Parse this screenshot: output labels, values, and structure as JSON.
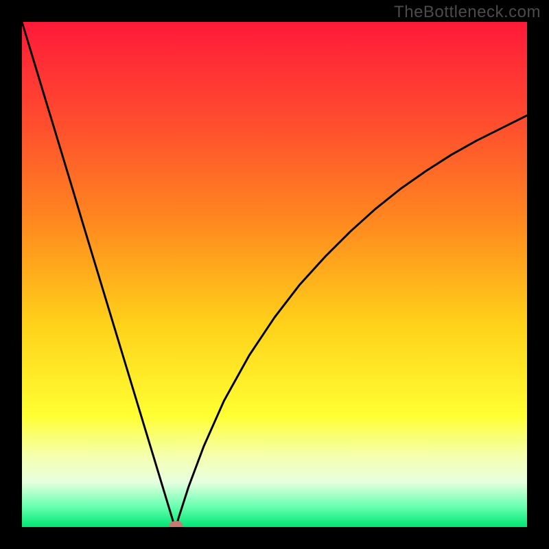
{
  "watermark": "TheBottleneck.com",
  "colors": {
    "frame": "#000000",
    "watermark_text": "#4b4b4b",
    "marker_fill": "#c77a6f",
    "curve_stroke": "#000000",
    "gradient_stops": [
      {
        "offset": 0.0,
        "color": "#ff1a3a"
      },
      {
        "offset": 0.2,
        "color": "#ff4d2e"
      },
      {
        "offset": 0.4,
        "color": "#ff8a1f"
      },
      {
        "offset": 0.6,
        "color": "#ffd21a"
      },
      {
        "offset": 0.78,
        "color": "#ffff33"
      },
      {
        "offset": 0.86,
        "color": "#f4ffb0"
      },
      {
        "offset": 0.91,
        "color": "#e9ffe0"
      },
      {
        "offset": 0.96,
        "color": "#66ffb0"
      },
      {
        "offset": 1.0,
        "color": "#00e673"
      }
    ]
  },
  "chart_data": {
    "type": "line",
    "title": "",
    "xlabel": "",
    "ylabel": "",
    "ylim": [
      0,
      100
    ],
    "x": [
      0.0,
      0.02,
      0.04,
      0.06,
      0.08,
      0.1,
      0.12,
      0.14,
      0.16,
      0.18,
      0.2,
      0.22,
      0.24,
      0.26,
      0.28,
      0.3,
      0.305,
      0.31,
      0.33,
      0.36,
      0.4,
      0.45,
      0.5,
      0.55,
      0.6,
      0.65,
      0.7,
      0.75,
      0.8,
      0.85,
      0.9,
      0.95,
      1.0
    ],
    "values": [
      100.0,
      93.4,
      86.8,
      80.2,
      73.6,
      67.0,
      60.3,
      53.7,
      47.1,
      40.5,
      33.9,
      27.3,
      20.7,
      14.1,
      7.5,
      0.9,
      0.0,
      1.8,
      8.0,
      16.0,
      25.0,
      34.0,
      41.5,
      48.0,
      53.5,
      58.5,
      63.0,
      67.0,
      70.5,
      73.7,
      76.5,
      79.0,
      81.5
    ],
    "marker": {
      "x": 0.305,
      "y": 0.0
    }
  }
}
